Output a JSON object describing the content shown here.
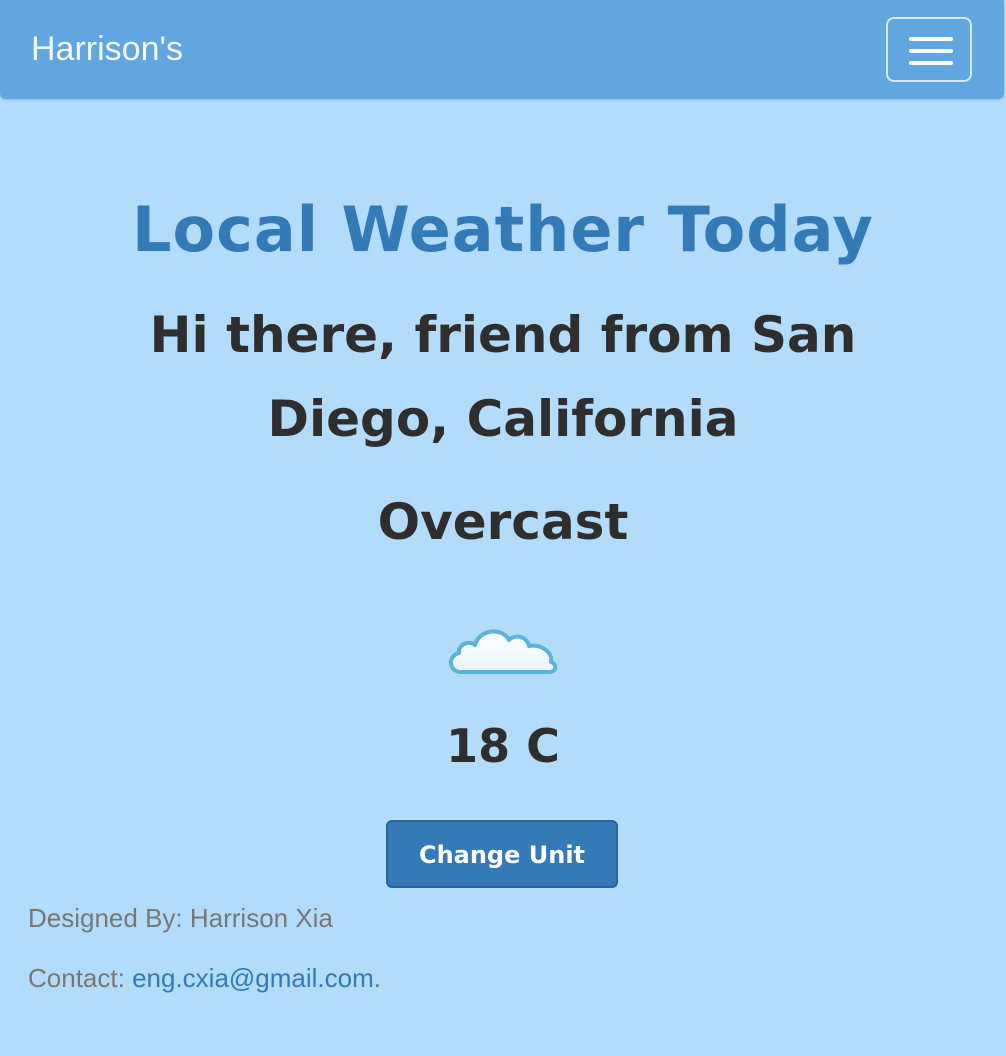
{
  "navbar": {
    "brand": "Harrison's",
    "menu_icon": "hamburger-menu-icon"
  },
  "main": {
    "title": "Local Weather Today",
    "greeting": "Hi there, friend from San Diego, California",
    "condition": "Overcast",
    "weather_icon": "cloud-icon",
    "temperature": "18 C",
    "change_unit_label": "Change Unit"
  },
  "footer": {
    "designed_by": "Designed By: Harrison Xia",
    "contact_prefix": "Contact: ",
    "email": "eng.cxia@gmail.com",
    "contact_suffix": "."
  },
  "colors": {
    "background": "#b3dcfa",
    "navbar": "#61a6df",
    "title": "#337ab7",
    "button": "#337ab7",
    "text_dark": "#2e2e2e",
    "footer_text": "#777777"
  }
}
